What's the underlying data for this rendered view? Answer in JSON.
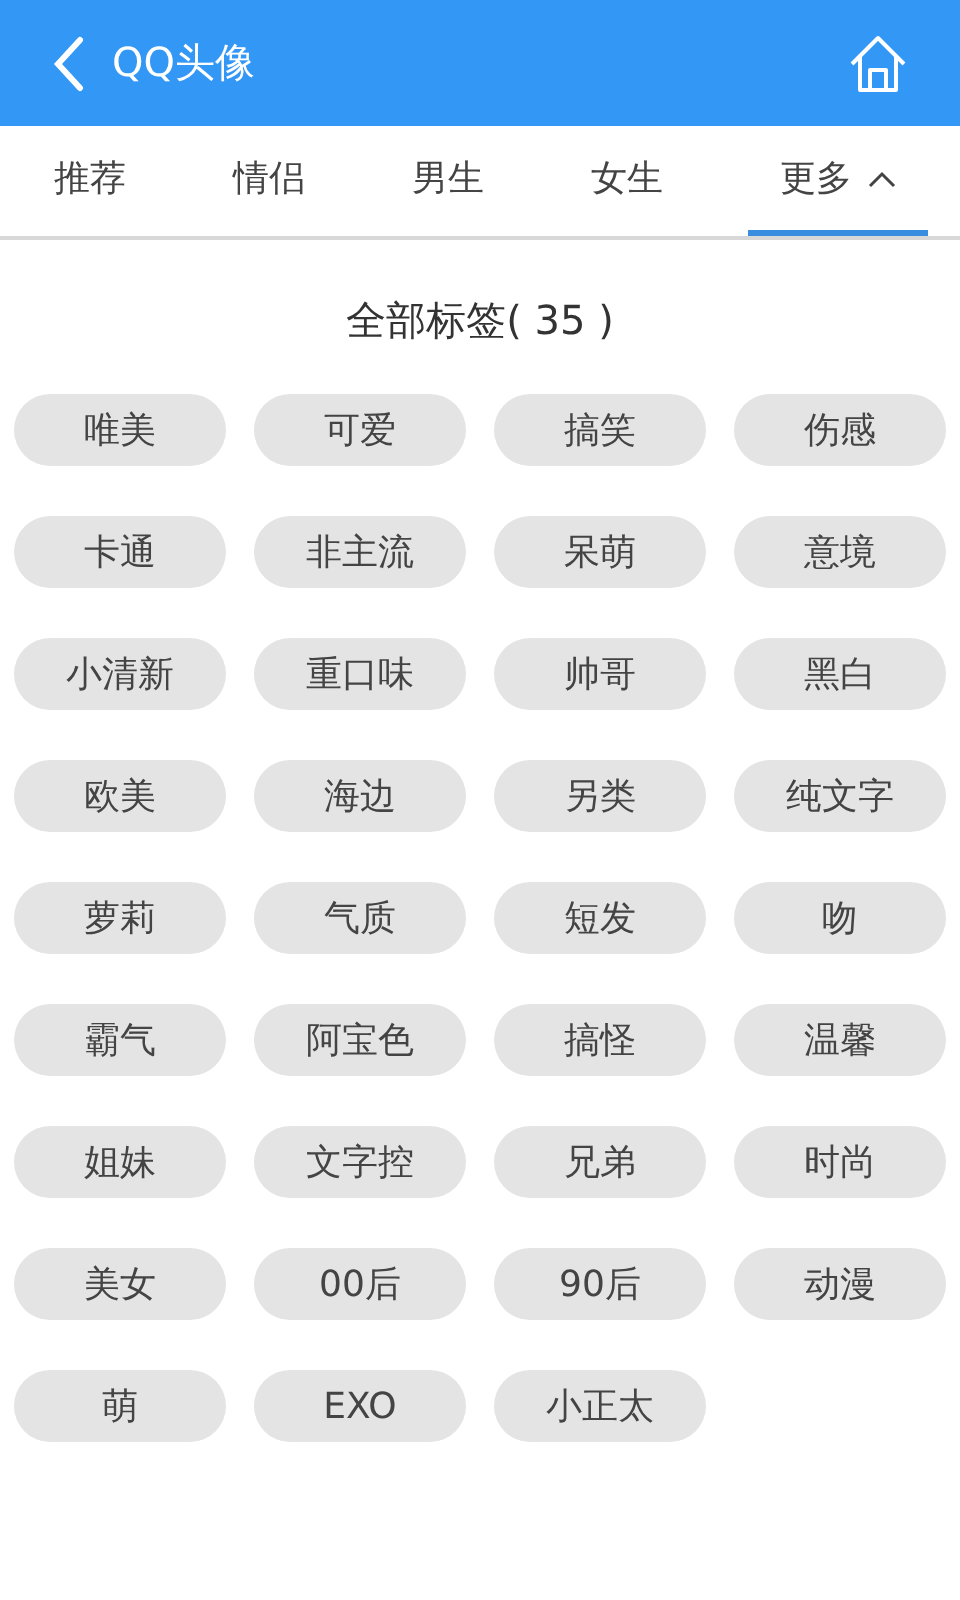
{
  "header": {
    "title": "QQ头像"
  },
  "tabs": [
    {
      "label": "推荐",
      "selected": false
    },
    {
      "label": "情侣",
      "selected": false
    },
    {
      "label": "男生",
      "selected": false
    },
    {
      "label": "女生",
      "selected": false
    },
    {
      "label": "更多",
      "selected": true,
      "expanded": true
    }
  ],
  "section_title": "全部标签( 35 )",
  "tags": [
    "唯美",
    "可爱",
    "搞笑",
    "伤感",
    "卡通",
    "非主流",
    "呆萌",
    "意境",
    "小清新",
    "重口味",
    "帅哥",
    "黑白",
    "欧美",
    "海边",
    "另类",
    "纯文字",
    "萝莉",
    "气质",
    "短发",
    "吻",
    "霸气",
    "阿宝色",
    "搞怪",
    "温馨",
    "姐妹",
    "文字控",
    "兄弟",
    "时尚",
    "美女",
    "00后",
    "90后",
    "动漫",
    "萌",
    "EXO",
    "小正太"
  ]
}
